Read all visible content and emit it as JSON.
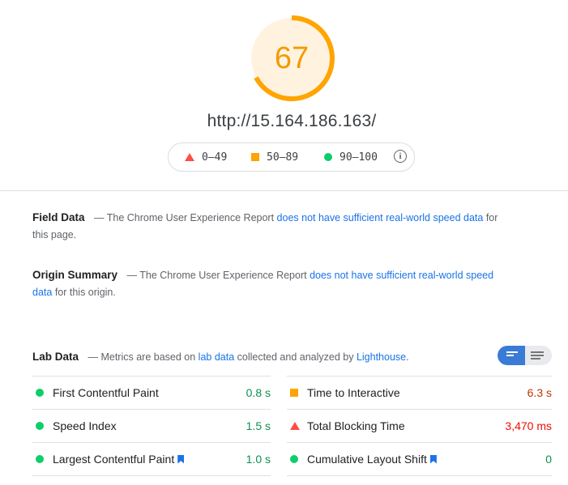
{
  "score": {
    "value": "67",
    "fraction": 0.67,
    "color": "#ffa400",
    "bg_color": "#fff3e0"
  },
  "url": "http://15.164.186.163/",
  "legend": {
    "fail": "0–49",
    "average": "50–89",
    "pass": "90–100",
    "info_icon": "info-icon"
  },
  "field_data": {
    "title": "Field Data",
    "text_before": " — The Chrome User Experience Report ",
    "link": "does not have sufficient real-world speed data",
    "text_after": " for this page."
  },
  "origin_summary": {
    "title": "Origin Summary",
    "text_before": " — The Chrome User Experience Report ",
    "link": "does not have sufficient real-world speed data",
    "text_after": " for this origin."
  },
  "lab_data": {
    "title": "Lab Data",
    "text_before": " — Metrics are based on ",
    "link1": "lab data",
    "text_mid": " collected and analyzed by ",
    "link2": "Lighthouse",
    "text_after": "."
  },
  "metrics_left": [
    {
      "label": "First Contentful Paint",
      "value": "0.8 s",
      "status": "pass",
      "bookmark": false
    },
    {
      "label": "Speed Index",
      "value": "1.5 s",
      "status": "pass",
      "bookmark": false
    },
    {
      "label": "Largest Contentful Paint",
      "value": "1.0 s",
      "status": "pass",
      "bookmark": true
    }
  ],
  "metrics_right": [
    {
      "label": "Time to Interactive",
      "value": "6.3 s",
      "status": "average",
      "bookmark": false
    },
    {
      "label": "Total Blocking Time",
      "value": "3,470 ms",
      "status": "fail",
      "bookmark": false
    },
    {
      "label": "Cumulative Layout Shift",
      "value": "0",
      "status": "pass",
      "bookmark": true
    }
  ],
  "colors": {
    "pass": "#0cce6b",
    "pass_text": "#0d904f",
    "average": "#ffa400",
    "average_text": "#c33300",
    "fail": "#ff4e42",
    "fail_text": "#eb0f00",
    "link": "#1a73e8"
  }
}
